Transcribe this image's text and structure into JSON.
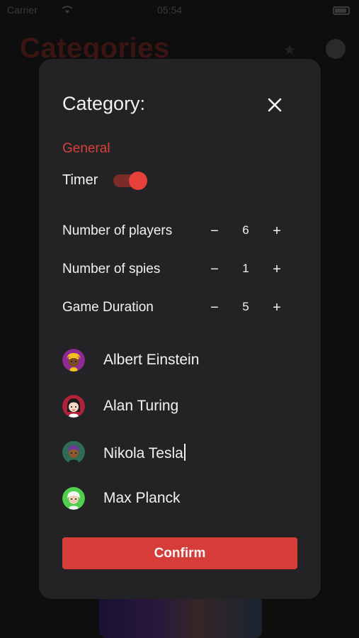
{
  "status_bar": {
    "carrier": "Carrier",
    "time": "05:54"
  },
  "background": {
    "title": "Categories"
  },
  "modal": {
    "title": "Category:",
    "section": "General",
    "timer": {
      "label": "Timer",
      "enabled": true
    },
    "settings": [
      {
        "label": "Number of players",
        "value": "6",
        "minus": "−",
        "plus": "+"
      },
      {
        "label": "Number of spies",
        "value": "1",
        "minus": "−",
        "plus": "+"
      },
      {
        "label": "Game Duration",
        "value": "5",
        "minus": "−",
        "plus": "+"
      }
    ],
    "players": [
      {
        "name": "Albert Einstein",
        "avatar_icon": "einstein-avatar-icon",
        "bg": "#8e2a96"
      },
      {
        "name": "Alan Turing",
        "avatar_icon": "turing-avatar-icon",
        "bg": "#b0213a"
      },
      {
        "name": "Nikola Tesla",
        "avatar_icon": "tesla-avatar-icon",
        "bg": "#2f6b55"
      },
      {
        "name": "Max Planck",
        "avatar_icon": "planck-avatar-icon",
        "bg": "#4fd04c"
      }
    ],
    "confirm_label": "Confirm"
  },
  "colors": {
    "accent": "#d63c38",
    "modal_bg": "#232325",
    "text": "#f2f2f2"
  }
}
